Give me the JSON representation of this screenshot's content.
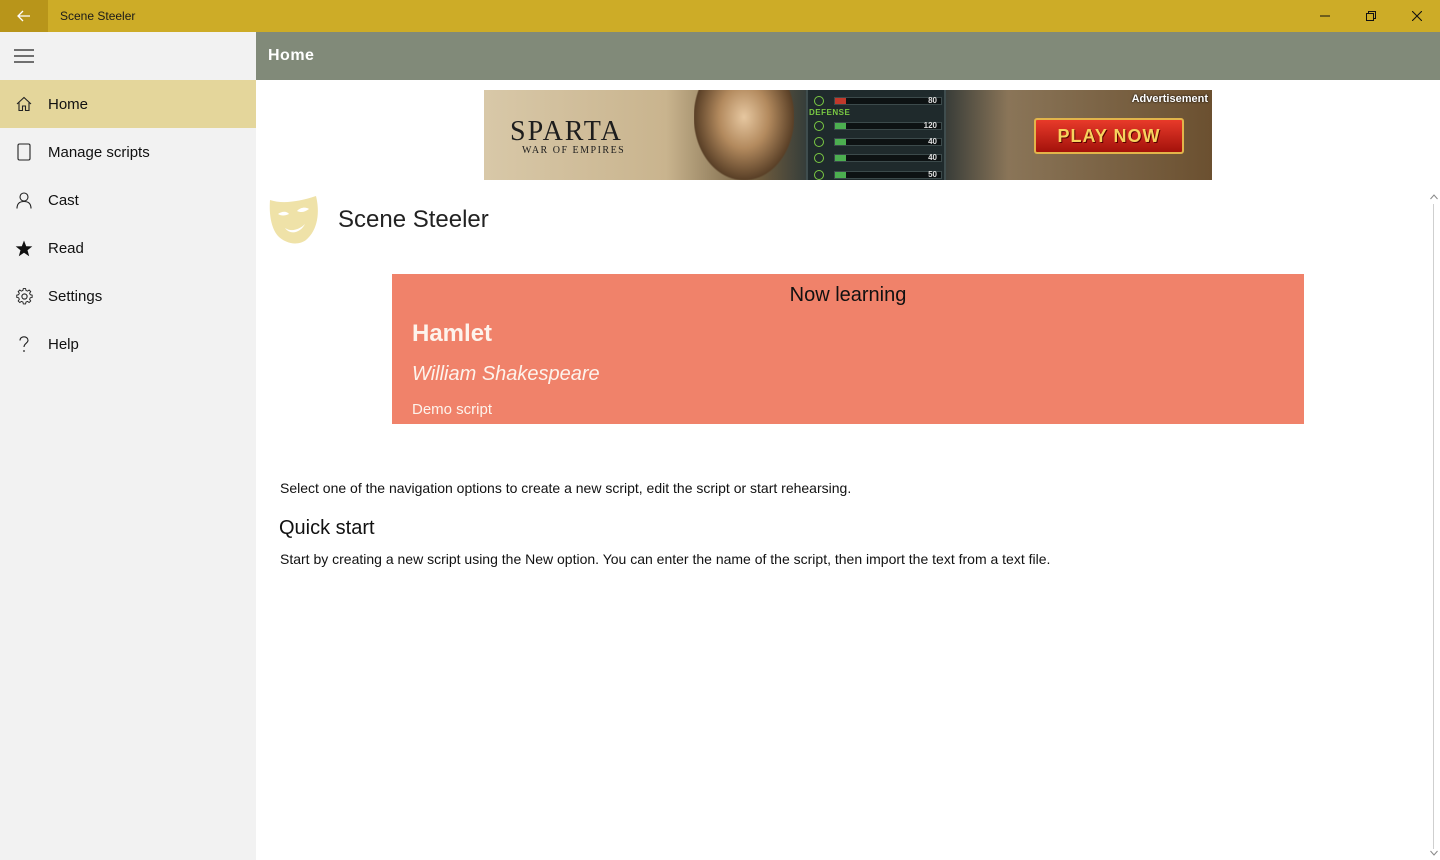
{
  "window": {
    "title": "Scene Steeler",
    "controls": [
      "minimize-icon",
      "restore-icon",
      "close-icon"
    ]
  },
  "colors": {
    "titlebar": "#cdac27",
    "sidebar_active": "#e4d69b",
    "header": "#818a79",
    "card": "#f0826a"
  },
  "sidebar": {
    "items": [
      {
        "label": "Home",
        "icon": "home-icon",
        "active": true
      },
      {
        "label": "Manage scripts",
        "icon": "document-icon",
        "active": false
      },
      {
        "label": "Cast",
        "icon": "person-icon",
        "active": false
      },
      {
        "label": "Read",
        "icon": "star-icon",
        "active": false
      },
      {
        "label": "Settings",
        "icon": "gear-icon",
        "active": false
      },
      {
        "label": "Help",
        "icon": "help-icon",
        "active": false
      }
    ]
  },
  "header": {
    "title": "Home"
  },
  "ad": {
    "label": "Advertisement",
    "title": "SPARTA",
    "subtitle": "WAR OF EMPIRES",
    "stat_heading": "DEFENSE",
    "stats": [
      "80",
      "120",
      "40",
      "40",
      "50"
    ],
    "button": "PLAY NOW"
  },
  "main": {
    "app_name": "Scene Steeler",
    "now_learning": {
      "heading": "Now learning",
      "title": "Hamlet",
      "author": "William Shakespeare",
      "subtitle": "Demo script"
    },
    "intro": "Select one of the navigation options to create a new script, edit the script or start rehearsing.",
    "quick_start": {
      "heading": "Quick start",
      "text": "Start by creating a new script using the New option. You can enter the name of the script, then import the text from a text file."
    }
  }
}
